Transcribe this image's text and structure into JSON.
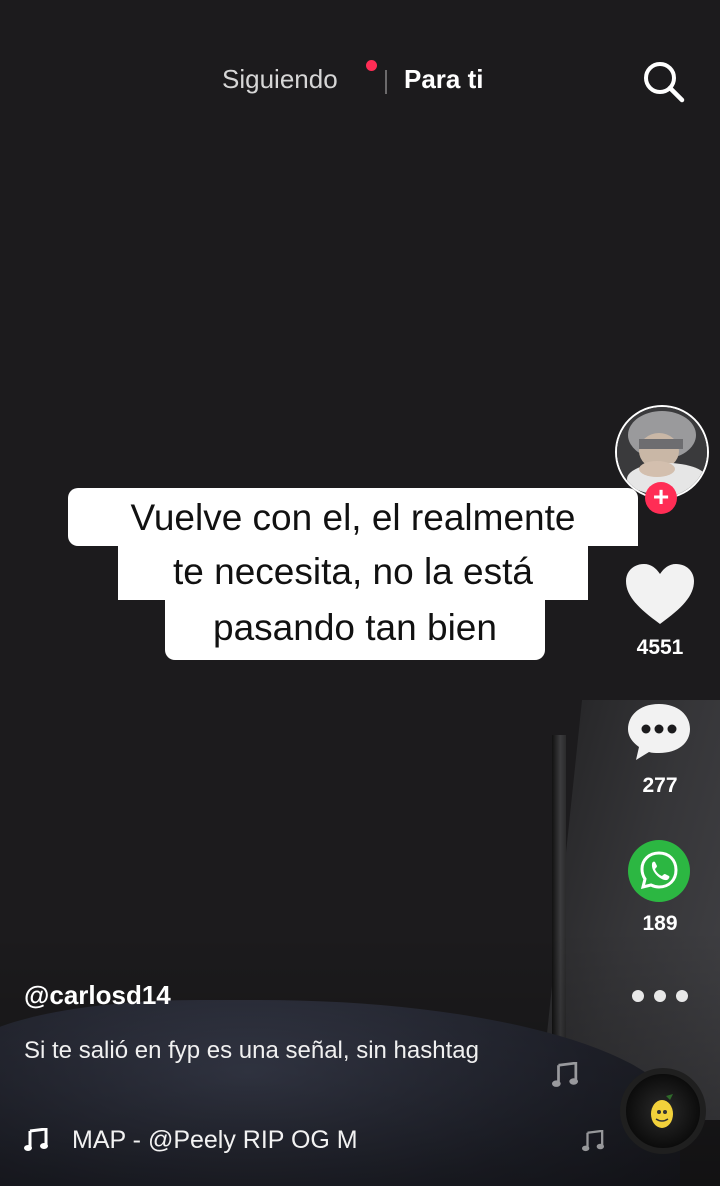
{
  "top_nav": {
    "following_label": "Siguiendo",
    "for_you_label": "Para ti",
    "search_icon": "search-icon"
  },
  "caption_overlay": {
    "lines": [
      "Vuelve con el, el realmente",
      "te necesita, no la está",
      "pasando tan bien"
    ]
  },
  "right_rail": {
    "follow_plus": "+",
    "like_count": "4551",
    "comment_count": "277",
    "share_count": "189",
    "share_icon": "whatsapp-icon",
    "accent_like_color": "#ffffff",
    "follow_color": "#ff2d55",
    "share_color": "#2cb742"
  },
  "post": {
    "username": "@carlosd14",
    "description": "Si te salió en fyp es una señal, sin hashtag",
    "music": "MAP - @Peely     RIP OG M"
  }
}
